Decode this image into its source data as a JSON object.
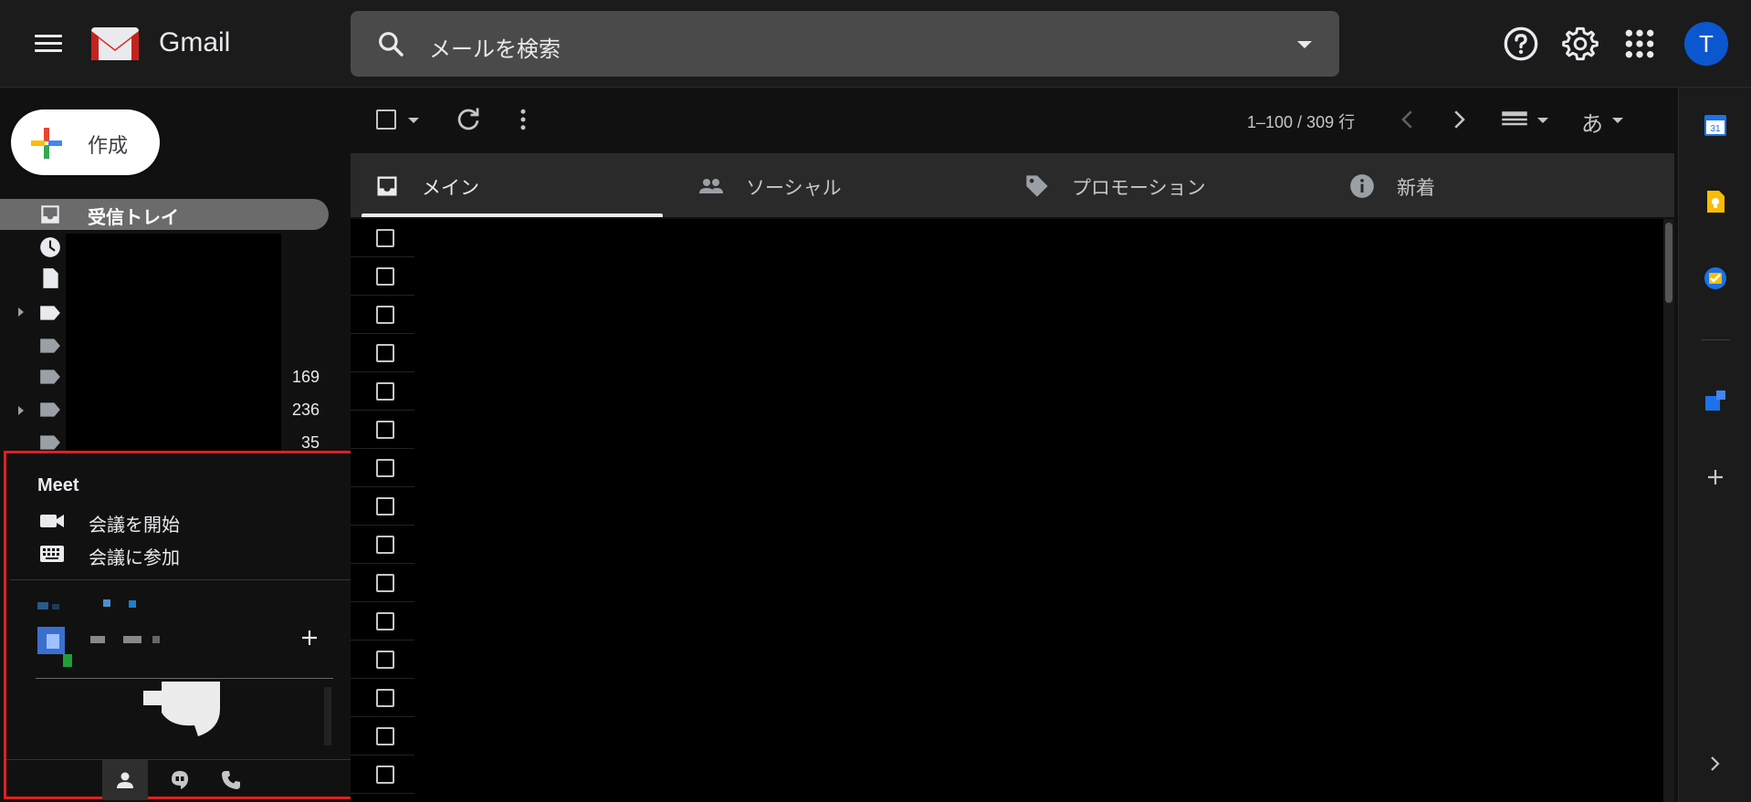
{
  "header": {
    "brand": "Gmail",
    "search_placeholder": "メールを検索",
    "avatar_letter": "T"
  },
  "nav": {
    "compose_label": "作成",
    "inbox_label": "受信トレイ",
    "counts": [
      "169",
      "236",
      "35"
    ]
  },
  "meet": {
    "title": "Meet",
    "start_meeting": "会議を開始",
    "join_meeting": "会議に参加"
  },
  "toolbar": {
    "pagination": "1–100 / 309 行",
    "input_tool": "あ"
  },
  "tabs": [
    {
      "label": "メイン",
      "icon": "inbox-icon"
    },
    {
      "label": "ソーシャル",
      "icon": "people-icon"
    },
    {
      "label": "プロモーション",
      "icon": "tag-icon"
    },
    {
      "label": "新着",
      "icon": "info-icon"
    }
  ],
  "side_panel": {
    "calendar_day": "31"
  },
  "colors": {
    "accent_blue": "#0b57d0",
    "panel_highlight": "#e21f1f",
    "background": "#111111"
  }
}
